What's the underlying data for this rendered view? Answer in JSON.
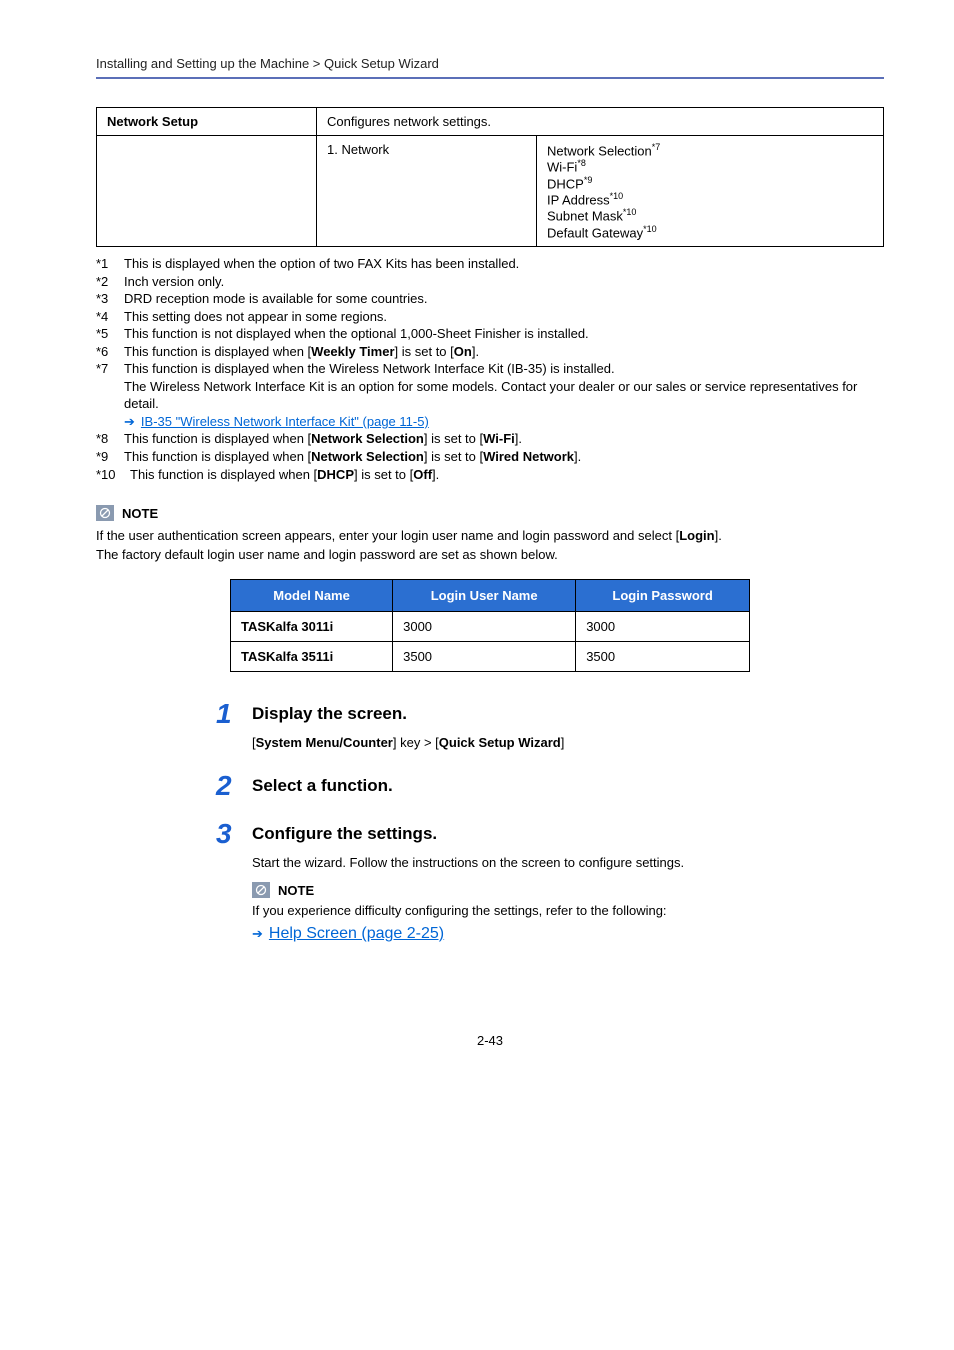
{
  "breadcrumb": "Installing and Setting up the Machine > Quick Setup Wizard",
  "table_network": {
    "row1": {
      "c1": "Network Setup",
      "c2": "Configures network settings."
    },
    "row2": {
      "c1": "1. Network",
      "items": {
        "0": {
          "text": "Network Selection",
          "sup": "*7"
        },
        "1": {
          "text": "Wi-Fi",
          "sup": "*8"
        },
        "2": {
          "text": "DHCP",
          "sup": "*9"
        },
        "3": {
          "text": "IP Address",
          "sup": "*10"
        },
        "4": {
          "text": "Subnet Mask",
          "sup": "*10"
        },
        "5": {
          "text": "Default Gateway",
          "sup": "*10"
        }
      }
    }
  },
  "footnotes": {
    "0": {
      "num": "*1",
      "text": "This is displayed when the option of two FAX Kits has been installed."
    },
    "1": {
      "num": "*2",
      "text": "Inch version only."
    },
    "2": {
      "num": "*3",
      "text": "DRD reception mode is available for some countries."
    },
    "3": {
      "num": "*4",
      "text": "This setting does not appear in some regions."
    },
    "4": {
      "num": "*5",
      "text": "This function is not displayed when the optional 1,000-Sheet Finisher is installed."
    },
    "5": {
      "num": "*6",
      "pre": "This function is displayed when [",
      "b": "Weekly Timer",
      "mid": "] is set to [",
      "b2": "On",
      "post": "]."
    },
    "6": {
      "num": "*7",
      "text": "This function is displayed when the Wireless Network Interface Kit (IB-35) is installed.",
      "text2": "The Wireless Network Interface Kit is an option for some models. Contact your dealer or our sales or service representatives for detail."
    },
    "6link": "IB-35 \"Wireless Network Interface Kit\" (page 11-5)",
    "7": {
      "num": "*8",
      "pre": "This function is displayed when [",
      "b": "Network Selection",
      "mid": "] is set to [",
      "b2": "Wi-Fi",
      "post": "]."
    },
    "8": {
      "num": "*9",
      "pre": "This function is displayed when [",
      "b": "Network Selection",
      "mid": "] is set to [",
      "b2": "Wired Network",
      "post": "]."
    },
    "9": {
      "num": "*10",
      "pre": "This function is displayed when [",
      "b": "DHCP",
      "mid": "] is set to [",
      "b2": "Off",
      "post": "]."
    }
  },
  "note1": {
    "label": "NOTE",
    "line1_pre": "If the user authentication screen appears, enter your login user name and login password and select [",
    "line1_b": "Login",
    "line1_post": "].",
    "line2": "The factory default login user name and login password are set as shown below."
  },
  "login_table": {
    "headers": {
      "0": "Model Name",
      "1": "Login User Name",
      "2": "Login Password"
    },
    "rows": {
      "0": {
        "model": "TASKalfa 3011i",
        "user": "3000",
        "pass": "3000"
      },
      "1": {
        "model": "TASKalfa 3511i",
        "user": "3500",
        "pass": "3500"
      }
    }
  },
  "steps": {
    "0": {
      "num": "1",
      "title": "Display the screen.",
      "body_pre": "[",
      "body_b1": "System Menu/Counter",
      "body_mid": "] key > [",
      "body_b2": "Quick Setup Wizard",
      "body_post": "]"
    },
    "1": {
      "num": "2",
      "title": "Select a function."
    },
    "2": {
      "num": "3",
      "title": "Configure the settings.",
      "body": "Start the wizard. Follow the instructions on the screen to configure settings.",
      "note_label": "NOTE",
      "note_body": "If you experience difficulty configuring the settings, refer to the following:",
      "note_link": "Help Screen (page 2-25)"
    }
  },
  "pagenum": "2-43"
}
